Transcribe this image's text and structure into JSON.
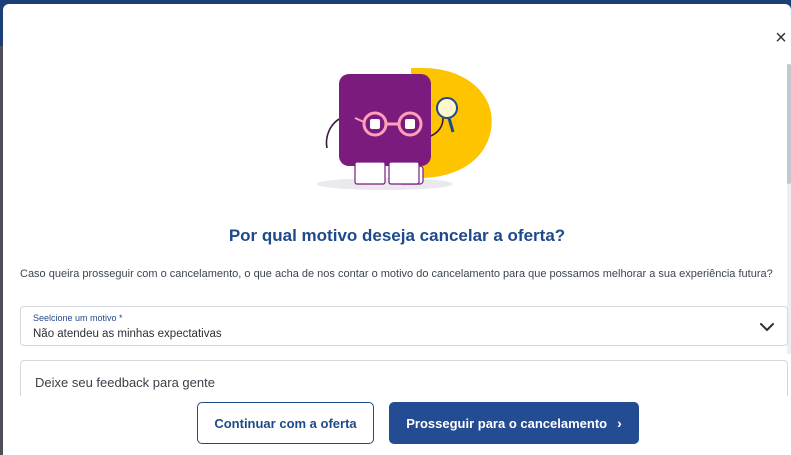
{
  "modal": {
    "close_glyph": "×",
    "title": "Por qual motivo deseja cancelar a oferta?",
    "description": "Caso queira prosseguir com o cancelamento, o que acha de nos contar o motivo do cancelamento para que possamos melhorar a sua experiência futura?",
    "select": {
      "label": "Seelcione um motivo *",
      "value": "Não atendeu as minhas expectativas",
      "icon": "chevron-down-icon"
    },
    "feedback": {
      "placeholder": "Deixe seu feedback para gente"
    },
    "buttons": {
      "continue_label": "Continuar com a oferta",
      "proceed_label": "Prosseguir para o cancelamento",
      "proceed_icon": "chevron-right-icon"
    }
  },
  "colors": {
    "brand_blue": "#234c93",
    "title_blue": "#1f4a8a",
    "mascot_purple": "#7b1b7e",
    "mascot_yellow": "#ffc400"
  }
}
